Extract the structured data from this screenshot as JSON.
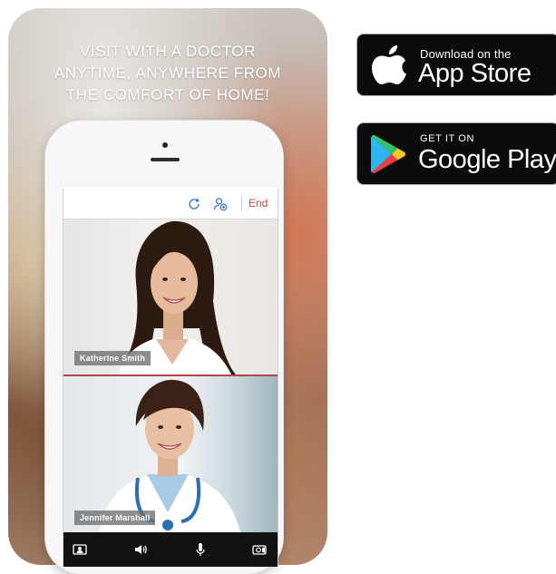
{
  "promo": {
    "headline_lines": [
      "VISIT WITH A DOCTOR",
      "ANYTIME, ANYWHERE FROM",
      "THE COMFORT OF HOME!"
    ]
  },
  "call_screen": {
    "toolbar": {
      "icons": [
        "refresh-icon",
        "add-participant-icon"
      ],
      "end_label": "End"
    },
    "participants": [
      {
        "name": "Katherine Smith"
      },
      {
        "name": "Jennifer Marshall"
      }
    ],
    "controls": [
      "contacts-icon",
      "speaker-icon",
      "microphone-icon",
      "camera-switch-icon"
    ],
    "colors": {
      "accent": "#3b7bd8",
      "end": "#e03c3c",
      "divider": "#b24646"
    }
  },
  "badges": {
    "apple": {
      "small": "Download on the",
      "big": "App Store"
    },
    "google": {
      "small": "GET IT ON",
      "big": "Google Play"
    }
  }
}
